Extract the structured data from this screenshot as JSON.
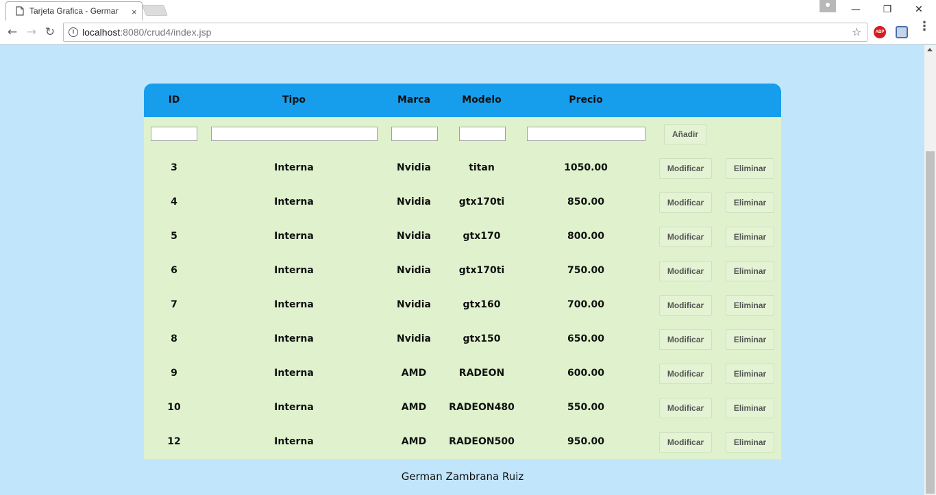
{
  "browser": {
    "tab_title": "Tarjeta Grafica - German",
    "tab_close": "×",
    "url_host": "localhost",
    "url_rest": ":8080/crud4/index.jsp",
    "window_minimize": "—",
    "window_restore": "❐",
    "window_close": "✕",
    "nav_back": "←",
    "nav_forward": "→",
    "nav_reload": "↻",
    "star": "☆",
    "abp_label": "ABP",
    "menu": "⋮"
  },
  "table": {
    "headers": {
      "id": "ID",
      "tipo": "Tipo",
      "marca": "Marca",
      "modelo": "Modelo",
      "precio": "Precio"
    },
    "add_button": "Añadir",
    "modify_label": "Modificar",
    "delete_label": "Eliminar",
    "rows": [
      {
        "id": "3",
        "tipo": "Interna",
        "marca": "Nvidia",
        "modelo": "titan",
        "precio": "1050.00"
      },
      {
        "id": "4",
        "tipo": "Interna",
        "marca": "Nvidia",
        "modelo": "gtx170ti",
        "precio": "850.00"
      },
      {
        "id": "5",
        "tipo": "Interna",
        "marca": "Nvidia",
        "modelo": "gtx170",
        "precio": "800.00"
      },
      {
        "id": "6",
        "tipo": "Interna",
        "marca": "Nvidia",
        "modelo": "gtx170ti",
        "precio": "750.00"
      },
      {
        "id": "7",
        "tipo": "Interna",
        "marca": "Nvidia",
        "modelo": "gtx160",
        "precio": "700.00"
      },
      {
        "id": "8",
        "tipo": "Interna",
        "marca": "Nvidia",
        "modelo": "gtx150",
        "precio": "650.00"
      },
      {
        "id": "9",
        "tipo": "Interna",
        "marca": "AMD",
        "modelo": "RADEON",
        "precio": "600.00"
      },
      {
        "id": "10",
        "tipo": "Interna",
        "marca": "AMD",
        "modelo": "RADEON480",
        "precio": "550.00"
      },
      {
        "id": "12",
        "tipo": "Interna",
        "marca": "AMD",
        "modelo": "RADEON500",
        "precio": "950.00"
      }
    ]
  },
  "footer": {
    "text": "German Zambrana Ruiz"
  },
  "colors": {
    "page_bg": "#c1e5fa",
    "header_bg": "#169eed",
    "table_bg": "#dff2cd"
  }
}
